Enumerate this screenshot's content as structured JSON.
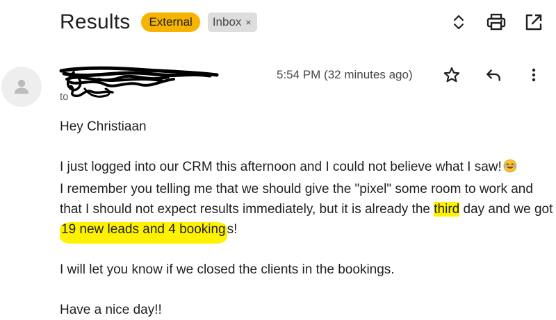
{
  "subject": {
    "title": "Results",
    "labels": {
      "external": "External",
      "inbox": "Inbox"
    },
    "remove_label_glyph": "×"
  },
  "toolbar_icons": [
    "expand-collapse-icon",
    "print-icon",
    "open-in-new-window-icon"
  ],
  "message": {
    "to_prefix": "to",
    "timestamp": "5:54 PM (32 minutes ago)",
    "action_icons": [
      "star-icon",
      "reply-icon",
      "more-vert-icon"
    ],
    "redacted_sender": true
  },
  "body": {
    "greeting": "Hey Christiaan",
    "p1_line1": "I just logged into our CRM this afternoon and I could not believe what I saw!",
    "p1_emoji": "😂",
    "p1_before_third": "I remember you telling me that we should give the \"pixel\" some room to work and that I should not expect results immediately, but it is already the ",
    "p1_third": "third",
    "p1_after_third": " day and we got ",
    "p1_highlight": "19 new leads and 4 booking",
    "p1_end": "s!",
    "p2": "I will let you know if we closed the clients in the bookings.",
    "p3": "Have a nice day!!"
  },
  "colors": {
    "external_label": "#f6b300",
    "inbox_label": "#dddddd",
    "highlight": "#fff200",
    "text": "#1f1f1f",
    "muted": "#444746"
  }
}
